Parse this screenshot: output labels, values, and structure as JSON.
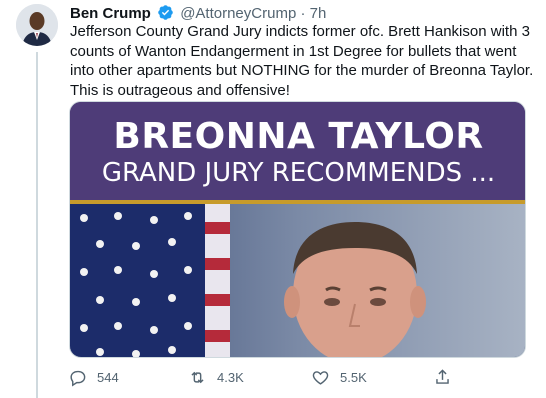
{
  "tweet": {
    "author_name": "Ben Crump",
    "handle": "@AttorneyCrump",
    "separator": "·",
    "time": "7h",
    "text": "Jefferson County Grand Jury indicts former ofc. Brett Hankison with 3 counts of Wanton Endangerment in 1st Degree for bullets that went into other apartments but NOTHING for the murder of Breonna Taylor. This is outrageous and offensive!",
    "media": {
      "headline": "BREONNA TAYLOR",
      "subheadline": "GRAND JURY RECOMMENDS ..."
    },
    "actions": {
      "reply_count": "544",
      "retweet_count": "4.3K",
      "like_count": "5.5K"
    }
  },
  "icons": {
    "verified": "verified-badge-icon",
    "reply": "reply-icon",
    "retweet": "retweet-icon",
    "like": "heart-icon",
    "share": "share-icon"
  },
  "colors": {
    "accent": "#1d9bf0",
    "text": "#0f1419",
    "secondary": "#536471",
    "banner": "#4e3c78",
    "banner_rule": "#c79b2b"
  }
}
